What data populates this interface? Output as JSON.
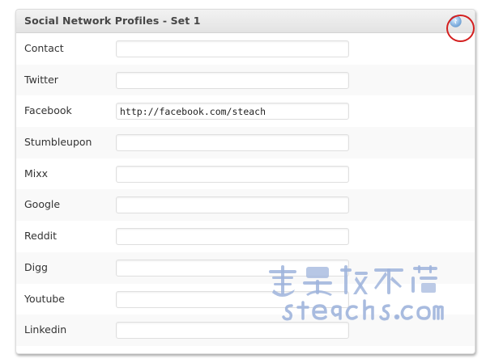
{
  "panel": {
    "title": "Social Network Profiles - Set 1",
    "collapse_icon": "info-circle-icon"
  },
  "fields": [
    {
      "label": "Contact",
      "value": ""
    },
    {
      "label": "Twitter",
      "value": ""
    },
    {
      "label": "Facebook",
      "value": "http://facebook.com/steach"
    },
    {
      "label": "Stumbleupon",
      "value": ""
    },
    {
      "label": "Mixx",
      "value": ""
    },
    {
      "label": "Google",
      "value": ""
    },
    {
      "label": "Reddit",
      "value": ""
    },
    {
      "label": "Digg",
      "value": ""
    },
    {
      "label": "Youtube",
      "value": ""
    },
    {
      "label": "Linkedin",
      "value": ""
    }
  ],
  "watermark": {
    "cjk_text": "就是教不落",
    "latin_text": "steachs.com"
  },
  "colors": {
    "highlight_ring": "#d41f1f",
    "watermark": "#9fb4dc",
    "header_text": "#464646"
  }
}
